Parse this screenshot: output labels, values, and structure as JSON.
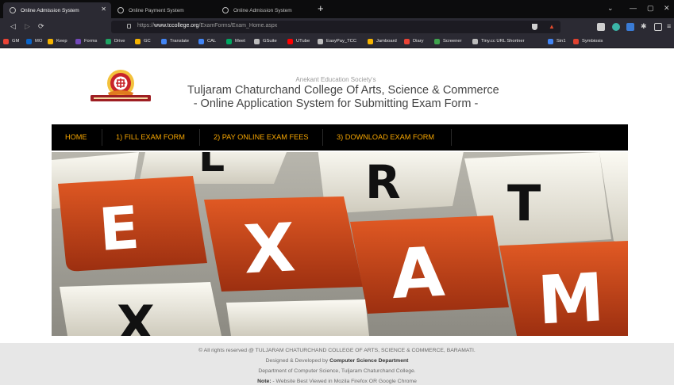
{
  "browser": {
    "tabs": [
      {
        "label": "Online Admission System",
        "active": true
      },
      {
        "label": "Online Payment System",
        "active": false
      },
      {
        "label": "Online Admission System",
        "active": false
      }
    ],
    "new_tab_symbol": "+",
    "window_controls": {
      "minimize": "—",
      "maximize": "▢",
      "close": "✕",
      "dropdown": "⌄"
    },
    "nav": {
      "back": "◁",
      "forward": "▷",
      "reload": "⟳"
    },
    "url": {
      "prefix": "https://",
      "domain": "www.tccollege.org",
      "path": "/ExamForms/Exam_Home.aspx"
    },
    "bookmarks": [
      {
        "label": "GM",
        "icon": "gmail-icon",
        "color": "#ea4335"
      },
      {
        "label": "MO",
        "icon": "outlook-icon",
        "color": "#0a64c8"
      },
      {
        "label": "Keep",
        "icon": "keep-icon",
        "color": "#f6b400"
      },
      {
        "label": "Forms",
        "icon": "forms-icon",
        "color": "#7248b9"
      },
      {
        "label": "Drive",
        "icon": "drive-icon",
        "color": "#1fa463"
      },
      {
        "label": "GC",
        "icon": "classroom-icon",
        "color": "#f6b400"
      },
      {
        "label": "Translate",
        "icon": "translate-icon",
        "color": "#4285f4"
      },
      {
        "label": "CAL",
        "icon": "calendar-icon",
        "color": "#4285f4"
      },
      {
        "label": "Meet",
        "icon": "meet-icon",
        "color": "#00a862"
      },
      {
        "label": "GSuite",
        "icon": "gsuite-icon",
        "color": "#bcbcbc"
      },
      {
        "label": "UTube",
        "icon": "youtube-icon",
        "color": "#ff0000"
      },
      {
        "label": "EasyPay_TCC",
        "icon": "globe-icon",
        "color": "#bcbcbc"
      },
      {
        "label": "Jamboard",
        "icon": "jamboard-icon",
        "color": "#f6b400"
      },
      {
        "label": "Diary",
        "icon": "diary-icon",
        "color": "#ea4335"
      },
      {
        "label": "Screener",
        "icon": "chart-icon",
        "color": "#3fa34d"
      },
      {
        "label": "Tiny.cc URL Shortner",
        "icon": "link-icon",
        "color": "#bcbcbc"
      },
      {
        "label": "Sin1",
        "icon": "sin1-icon",
        "color": "#4285f4"
      },
      {
        "label": "Symbiosis",
        "icon": "symbiosis-icon",
        "color": "#e0412f"
      }
    ]
  },
  "header": {
    "society": "Anekant Education Society's",
    "college": "Tuljaram Chaturchand College Of Arts, Science & Commerce",
    "system": "- Online Application System for Submitting Exam Form -"
  },
  "menu": {
    "items": [
      "HOME",
      "1) FILL EXAM FORM",
      "2) PAY ONLINE EXAM FEES",
      "3) DOWNLOAD EXAM FORM"
    ],
    "color": "#f7a600"
  },
  "banner": {
    "keys": [
      "E",
      "X",
      "A",
      "M",
      "L",
      "R",
      "T",
      "X"
    ],
    "accent": "#c8441c"
  },
  "footer": {
    "copyright": "© All rights reserved @ TULJARAM CHATURCHAND COLLEGE OF ARTS, SCIENCE & COMMERCE, BARAMATI.",
    "designed_prefix": "Designed & Developed by ",
    "designed_by": "Computer Science Department",
    "department": "Department of Computer Science, Tuljaram Chaturchand College.",
    "note_label": "Note:",
    "note_text": " - Website Best Viewed in Mozila Firefox OR Google Chrome"
  }
}
